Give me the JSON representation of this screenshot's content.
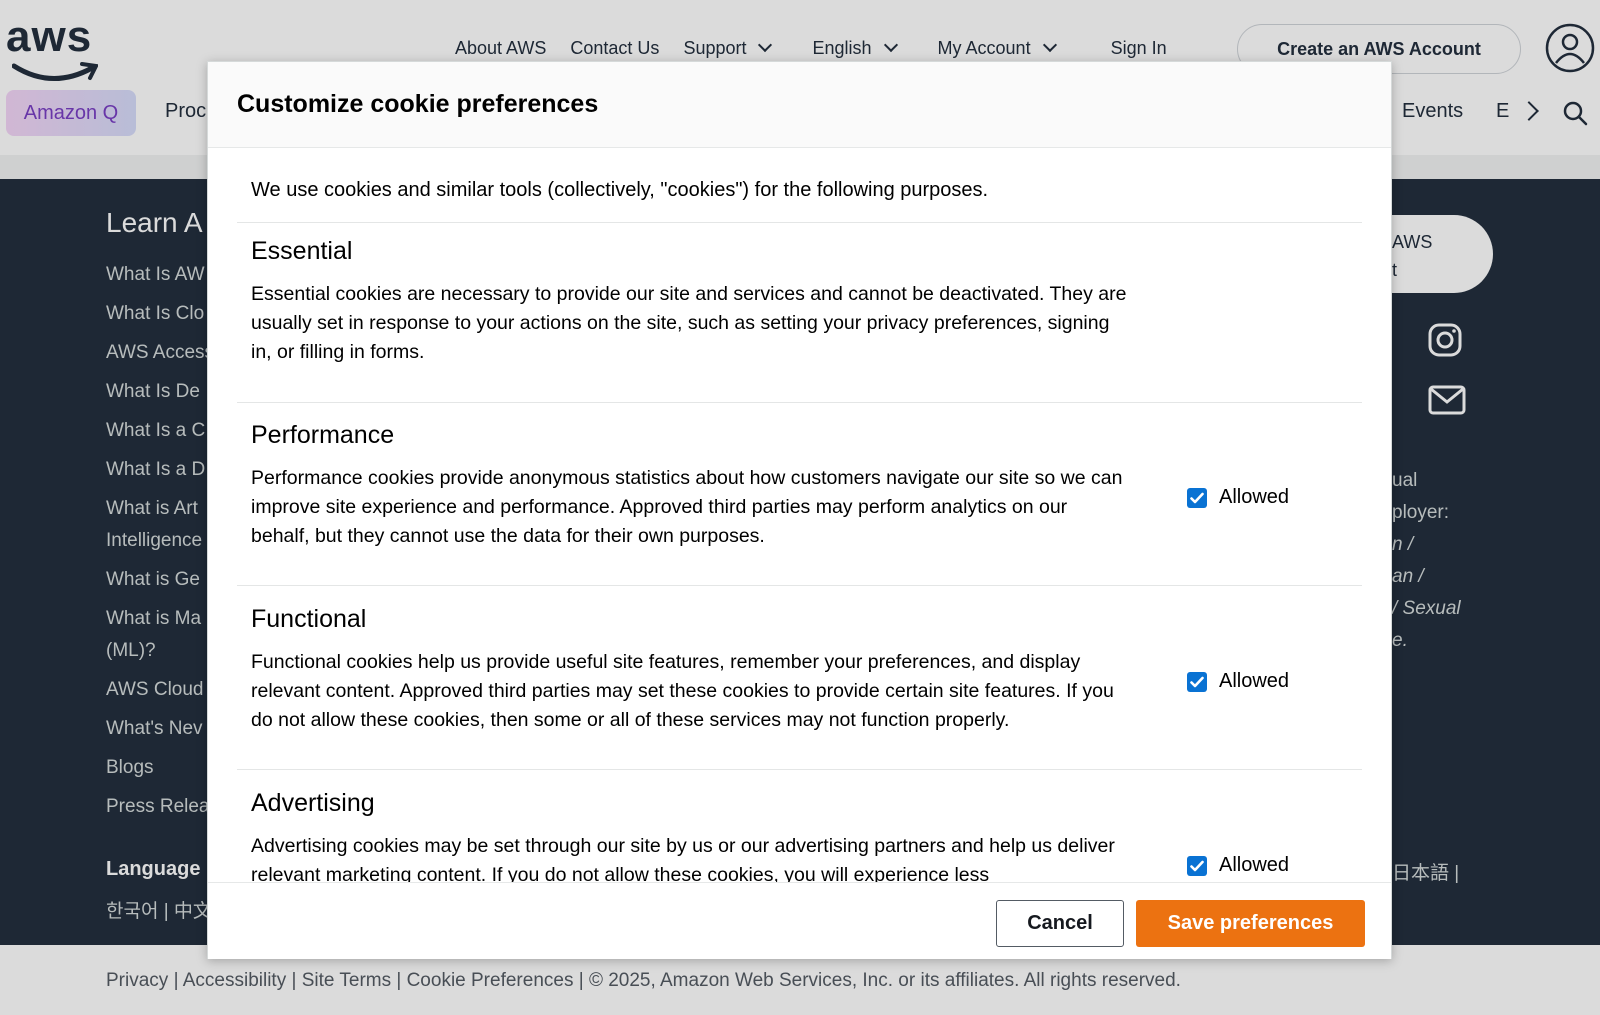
{
  "header": {
    "logo_text": "aws",
    "nav": [
      "About AWS",
      "Contact Us",
      "Support",
      "English",
      "My Account",
      "Sign In"
    ],
    "create_account": "Create an AWS Account",
    "subnav": {
      "amazon_q": "Amazon Q",
      "products": "Proc",
      "events": "Events",
      "more": "E"
    }
  },
  "background": {
    "learn_title": "Learn A",
    "learn_links": [
      "What Is AW",
      "What Is Clo",
      "AWS Access",
      "What Is De",
      "What Is a C",
      "What Is a D",
      "What is Art",
      "Intelligence",
      "What is Ge",
      "What is Ma",
      "(ML)?",
      "AWS Cloud",
      "What's Nev",
      "Blogs",
      "Press Relea"
    ],
    "language_title": "Language",
    "language_row": "한국어 | 中文",
    "language_right": "日本語 |",
    "pill_text": [
      "AWS",
      "t"
    ],
    "eo_lines": [
      "ual",
      "ployer:",
      "n /",
      "an /",
      "/ Sexual",
      "e."
    ],
    "legal": "Privacy  |  Accessibility  |  Site Terms  |  Cookie Preferences  |  © 2025, Amazon Web Services, Inc. or its affiliates. All rights reserved."
  },
  "modal": {
    "title": "Customize cookie preferences",
    "intro": "We use cookies and similar tools (collectively, \"cookies\") for the following purposes.",
    "categories": [
      {
        "title": "Essential",
        "description": "Essential cookies are necessary to provide our site and services and cannot be deactivated. They are usually set in response to your actions on the site, such as setting your privacy preferences, signing in, or filling in forms."
      },
      {
        "title": "Performance",
        "description": "Performance cookies provide anonymous statistics about how customers navigate our site so we can improve site experience and performance. Approved third parties may perform analytics on our behalf, but they cannot use the data for their own purposes.",
        "toggle_label": "Allowed",
        "checked": true
      },
      {
        "title": "Functional",
        "description": "Functional cookies help us provide useful site features, remember your preferences, and display relevant content. Approved third parties may set these cookies to provide certain site features. If you do not allow these cookies, then some or all of these services may not function properly.",
        "toggle_label": "Allowed",
        "checked": true
      },
      {
        "title": "Advertising",
        "description": "Advertising cookies may be set through our site by us or our advertising partners and help us deliver relevant marketing content. If you do not allow these cookies, you will experience less",
        "toggle_label": "Allowed",
        "checked": true
      }
    ],
    "cancel_label": "Cancel",
    "save_label": "Save preferences"
  },
  "colors": {
    "accent": "#ec7211",
    "checkbox": "#0972d3",
    "footer_bg": "#232f3e"
  }
}
